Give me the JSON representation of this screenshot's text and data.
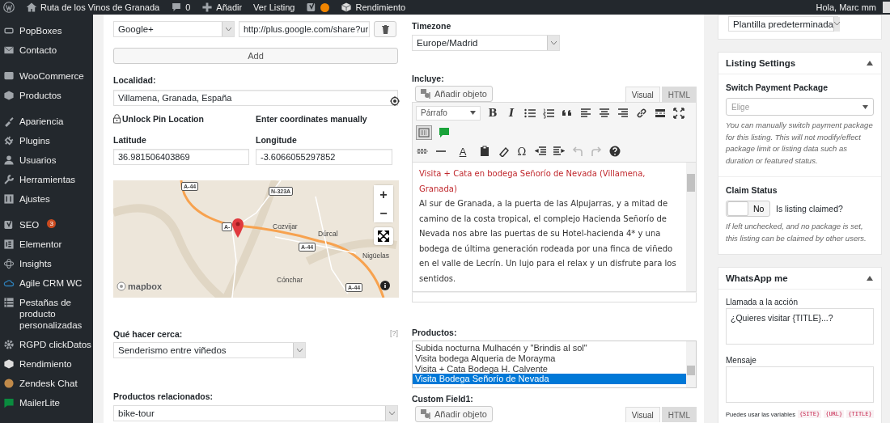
{
  "admin_bar": {
    "site_title": "Ruta de los Vinos de Granada",
    "comments_count": "0",
    "new_label": "Añadir",
    "view_label": "Ver Listing",
    "performance_label": "Rendimiento",
    "greeting": "Hola, Marc mm"
  },
  "sidebar": {
    "items": [
      {
        "label": "PopBoxes",
        "selected": false
      },
      {
        "label": "Contacto",
        "selected": false
      },
      {
        "label": "WooCommerce",
        "selected": false
      },
      {
        "label": "Productos",
        "selected": false
      },
      {
        "label": "Apariencia",
        "selected": false
      },
      {
        "label": "Plugins",
        "selected": false
      },
      {
        "label": "Usuarios",
        "selected": false
      },
      {
        "label": "Herramientas",
        "selected": false
      },
      {
        "label": "Ajustes",
        "selected": false
      },
      {
        "label": "SEO",
        "selected": false,
        "badge": "3"
      },
      {
        "label": "Elementor",
        "selected": false
      },
      {
        "label": "Insights",
        "selected": false
      },
      {
        "label": "Agile CRM WC",
        "selected": false
      },
      {
        "label": "Pestañas de producto personalizadas",
        "selected": false
      },
      {
        "label": "RGPD clickDatos",
        "selected": false
      },
      {
        "label": "Rendimiento",
        "selected": false
      },
      {
        "label": "Zendesk Chat",
        "selected": false
      },
      {
        "label": "MailerLite",
        "selected": false
      }
    ]
  },
  "social": {
    "network": "Google+",
    "url": "http://plus.google.com/share?ur",
    "add_label": "Add"
  },
  "location": {
    "label": "Localidad:",
    "value": "Villamena, Granada, España",
    "unlock_label": "Unlock Pin Location",
    "manual_label": "Enter coordinates manually",
    "latitude_label": "Latitude",
    "latitude": "36.981506403869",
    "longitude_label": "Longitude",
    "longitude": "-3.6066055297852"
  },
  "map": {
    "labels": [
      "A-44",
      "N-323A",
      "A-",
      "Cozvijar",
      "Dúrcal",
      "A-44",
      "Nigüelas",
      "Cónchar",
      "A-44"
    ],
    "zoom_in": "+",
    "zoom_out": "−",
    "attribution": "mapbox"
  },
  "nearby": {
    "label": "Qué hacer cerca:",
    "help": "[?]",
    "value": "Senderismo entre viñedos"
  },
  "related": {
    "label": "Productos relacionados:",
    "value": "bike-tour"
  },
  "timezone": {
    "label": "Timezone",
    "value": "Europe/Madrid"
  },
  "includes": {
    "label": "Incluye:",
    "add_media": "Añadir objeto",
    "tabs": [
      {
        "label": "Visual",
        "selected": true
      },
      {
        "label": "HTML",
        "selected": false
      }
    ],
    "toolbar": {
      "format": "Párrafo",
      "bold": "B",
      "italic": "I",
      "text_color": "A",
      "special_char": "Ω",
      "history_disabled": true
    },
    "title": "Visita + Cata en bodega Señorío de Nevada (Villamena, Granada)",
    "body": "Al sur de Granada, a la puerta de las Alpujarras, y a mitad de camino de la costa tropical, el complejo Hacienda Señorío de Nevada nos abre las puertas de su Hotel-hacienda 4* y una bodega de última generación rodeada por una finca de viñedo en el valle de Lecrín. Un lujo para el relax y un disfrute para los sentidos."
  },
  "products": {
    "label": "Productos:",
    "options": [
      {
        "label": "Subida nocturna Mulhacén y \"Brindis al sol\"",
        "selected": false
      },
      {
        "label": "Visita bodega Alqueria de Morayma",
        "selected": false
      },
      {
        "label": "Visita + Cata Bodega H. Calvente",
        "selected": false
      },
      {
        "label": "Visita Bodega Señorío de Nevada",
        "selected": true
      }
    ]
  },
  "custom_field": {
    "label": "Custom Field1:",
    "add_media": "Añadir objeto",
    "tabs": [
      {
        "label": "Visual",
        "selected": true
      },
      {
        "label": "HTML",
        "selected": false
      }
    ]
  },
  "template": {
    "value": "Plantilla predeterminada"
  },
  "listing_settings": {
    "title": "Listing Settings",
    "package_label": "Switch Payment Package",
    "package_placeholder": "Elige",
    "package_help": "You can manually switch payment package for this listing. This will not modify/effect package limit or listing data such as duration or featured status.",
    "claim_label": "Claim Status",
    "claimed": false,
    "toggle_label": "No",
    "claim_question": "Is listing claimed?",
    "claim_help": "If left unchecked, and no package is set, this listing can be claimed by other users."
  },
  "whatsapp": {
    "title": "WhatsApp me",
    "cta_label": "Llamada a la acción",
    "cta_value": "¿Quieres visitar {TITLE}...?",
    "message_label": "Mensaje",
    "hint": "Puedes usar las variables",
    "variables": [
      "{SITE}",
      "{URL}",
      "{TITLE}"
    ]
  }
}
